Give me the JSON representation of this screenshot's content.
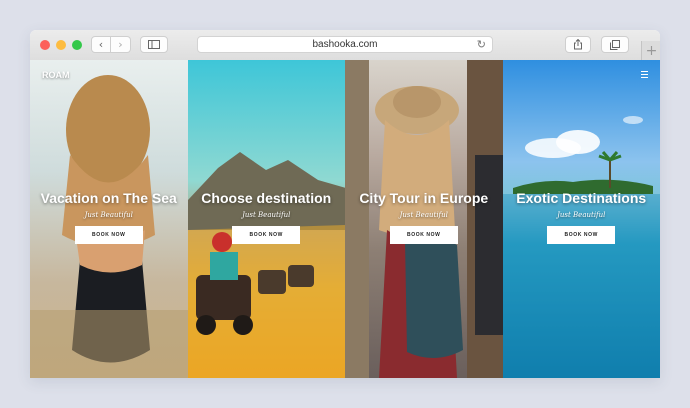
{
  "browser": {
    "url": "bashooka.com",
    "icons": {
      "back": "chevron-left-icon",
      "forward": "chevron-right-icon",
      "sidebar": "sidebar-icon",
      "reload": "reload-icon",
      "share": "share-icon",
      "tabs": "tabs-icon",
      "new_tab": "plus-icon"
    },
    "glyphs": {
      "back": "‹",
      "forward": "›",
      "reload": "↻",
      "new_tab": "+"
    },
    "traffic_lights": [
      "#fc605b",
      "#fdbc40",
      "#34c84a"
    ]
  },
  "site": {
    "logo": "ROAM",
    "menu_icon": "hamburger-menu-icon",
    "panels": [
      {
        "title": "Vacation on The Sea",
        "subtitle": "Just Beautiful",
        "button": "BOOK NOW"
      },
      {
        "title": "Choose destination",
        "subtitle": "Just Beautiful",
        "button": "BOOK NOW"
      },
      {
        "title": "City Tour in Europe",
        "subtitle": "Just Beautiful",
        "button": "BOOK NOW"
      },
      {
        "title": "Exotic Destinations",
        "subtitle": "Just Beautiful",
        "button": "BOOK NOW"
      }
    ]
  },
  "colors": {
    "page_background": "#dde0ea",
    "toolbar": "#e4e4e4",
    "button_bg": "#ffffff"
  }
}
